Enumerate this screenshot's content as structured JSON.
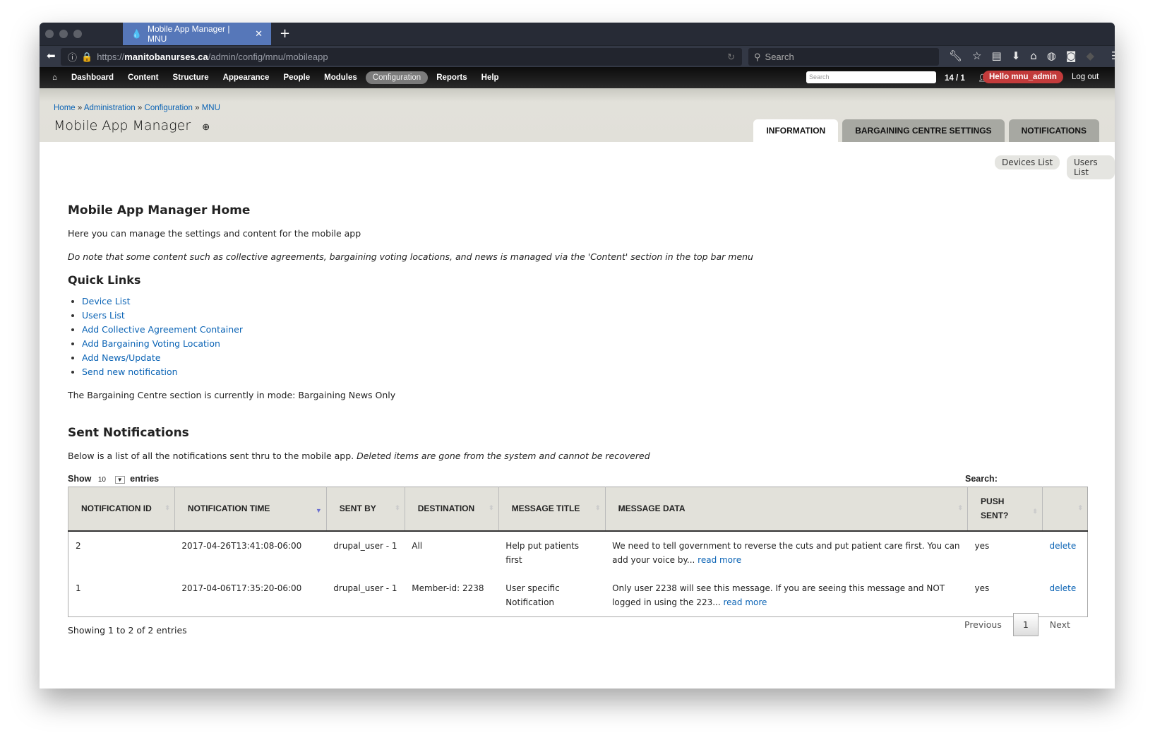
{
  "browser": {
    "tab_title": "Mobile App Manager | MNU",
    "url_prefix": "https://",
    "url_domain": "manitobanurses.ca",
    "url_path": "/admin/config/mnu/mobileapp",
    "search_placeholder": "Search"
  },
  "admin_menu": {
    "items": [
      "Dashboard",
      "Content",
      "Structure",
      "Appearance",
      "People",
      "Modules",
      "Configuration",
      "Reports",
      "Help"
    ],
    "active": "Configuration",
    "search_placeholder": "Search",
    "count": "14 / 1",
    "hello": "Hello mnu_admin",
    "logout": "Log out"
  },
  "breadcrumb": [
    "Home",
    "Administration",
    "Configuration",
    "MNU"
  ],
  "page_title": "Mobile App Manager",
  "tabs": [
    "INFORMATION",
    "BARGAINING CENTRE SETTINGS",
    "NOTIFICATIONS"
  ],
  "buttons": {
    "devices": "Devices List",
    "users": "Users List"
  },
  "home": {
    "heading": "Mobile App Manager Home",
    "intro": "Here you can manage the settings and content for the mobile app",
    "note": "Do note that some content such as collective agreements, bargaining voting locations, and news is managed via the 'Content' section in the top bar menu",
    "quick_links_heading": "Quick Links",
    "quick_links": [
      "Device List",
      "Users List",
      "Add Collective Agreement Container",
      "Add Bargaining Voting Location",
      "Add News/Update",
      "Send new notification"
    ],
    "mode": "The Bargaining Centre section is currently in mode: Bargaining News Only"
  },
  "notifications": {
    "heading": "Sent Notifications",
    "desc": "Below is a list of all the notifications sent thru to the mobile app.",
    "desc_italic": "Deleted items are gone from the system and cannot be recovered",
    "show_label": "Show",
    "show_value": "10",
    "entries_label": "entries",
    "search_label": "Search:",
    "columns": [
      "NOTIFICATION ID",
      "NOTIFICATION TIME",
      "SENT BY",
      "DESTINATION",
      "MESSAGE TITLE",
      "MESSAGE DATA",
      "PUSH SENT?",
      ""
    ],
    "rows": [
      {
        "id": "2",
        "time": "2017-04-26T13:41:08-06:00",
        "sent_by": "drupal_user - 1",
        "destination": "All",
        "title": "Help put patients first",
        "data": "We need to tell government to reverse the cuts and put patient care first. You can add your voice by...",
        "read_more": "read more",
        "push": "yes",
        "action": "delete"
      },
      {
        "id": "1",
        "time": "2017-04-06T17:35:20-06:00",
        "sent_by": "drupal_user - 1",
        "destination": "Member-id: 2238",
        "title": "User specific Notification",
        "data": "Only user 2238 will see this message. If you are seeing this message and NOT logged in using the 223...",
        "read_more": "read more",
        "push": "yes",
        "action": "delete"
      }
    ],
    "info": "Showing 1 to 2 of 2 entries",
    "prev": "Previous",
    "page": "1",
    "next": "Next"
  }
}
